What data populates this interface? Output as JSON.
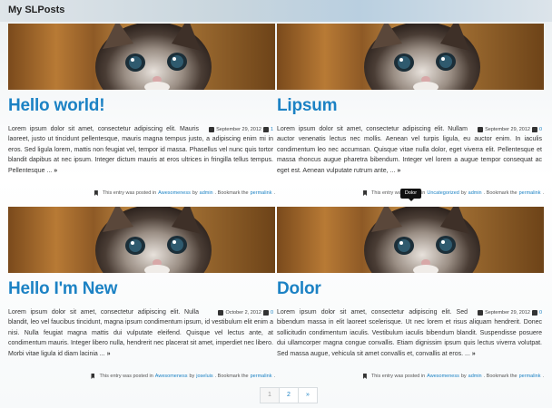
{
  "site": {
    "title": "My SLPosts"
  },
  "posts": [
    {
      "title": "Hello world!",
      "date": "September 29, 2012",
      "comments": "1",
      "excerpt": "Lorem ipsum dolor sit amet, consectetur adipiscing elit. Mauris laoreet, justo ut tincidunt pellentesque, mauris magna tempus justo, a adipiscing enim mi in eros. Sed ligula lorem, mattis non feugiat vel, tempor id massa. Phasellus vel nunc quis tortor blandit dapibus at nec ipsum. Integer dictum mauris at eros ultrices in fringilla tellus tempus. Pellentesque ...",
      "footer_prefix": "This entry was posted in",
      "category": "Awesomeness",
      "by": "by",
      "author": "admin",
      "bookmark_text": ". Bookmark the",
      "permalink": "permalink",
      "period": "."
    },
    {
      "title": "Lipsum",
      "date": "September 29, 2012",
      "comments": "0",
      "excerpt": "Lorem ipsum dolor sit amet, consectetur adipiscing elit. Nullam auctor venenatis lectus nec mollis. Aenean vel turpis ligula, eu auctor enim. In iaculis condimentum leo nec accumsan. Quisque vitae nulla dolor, eget viverra elit. Pellentesque et massa rhoncus augue pharetra bibendum. Integer vel lorem a augue tempor consequat ac eget est. Aenean vulputate rutrum ante, ...",
      "footer_prefix": "This entry was posted in",
      "category": "Uncategorized",
      "by": "by",
      "author": "admin",
      "bookmark_text": ". Bookmark the",
      "permalink": "permalink",
      "period": "."
    },
    {
      "title": "Hello I'm New",
      "date": "October 2, 2012",
      "comments": "0",
      "excerpt": "Lorem ipsum dolor sit amet, consectetur adipiscing elit. Nulla blandit, leo vel faucibus tincidunt, magna ipsum condimentum ipsum, id vestibulum elit enim a nisi. Nulla feugiat magna mattis dui vulputate eleifend. Quisque vel lectus ante, at condimentum mauris. Integer libero nulla, hendrerit nec placerat sit amet, imperdiet nec libero. Morbi vitae ligula id diam lacinia ...",
      "footer_prefix": "This entry was posted in",
      "category": "Awesomeness",
      "by": "by",
      "author": "joseluis",
      "bookmark_text": ". Bookmark the",
      "permalink": "permalink",
      "period": "."
    },
    {
      "title": "Dolor",
      "date": "September 29, 2012",
      "comments": "0",
      "excerpt": "Lorem ipsum dolor sit amet, consectetur adipiscing elit. Sed bibendum massa in elit laoreet scelerisque. Ut nec lorem et risus aliquam hendrerit. Donec sollicitudin condimentum iaculis. Vestibulum iaculis bibendum blandit. Suspendisse posuere dui ullamcorper magna congue convallis. Etiam dignissim ipsum quis lectus viverra volutpat. Sed massa augue, vehicula sit amet convallis et, convallis at eros. ...",
      "footer_prefix": "This entry was posted in",
      "category": "Awesomeness",
      "by": "by",
      "author": "admin",
      "bookmark_text": ". Bookmark the",
      "permalink": "permalink",
      "period": "."
    }
  ],
  "tooltip": {
    "text": "Dolor"
  },
  "pagination": {
    "page1": "1",
    "page2": "2",
    "next": "»"
  },
  "icons": {
    "calendar": "calendar-icon",
    "comment": "comment-icon",
    "bookmark": "bookmark-icon",
    "more": "double-chevron-right-icon"
  },
  "colors": {
    "link": "#1c82c4",
    "title": "#1c82c4"
  }
}
